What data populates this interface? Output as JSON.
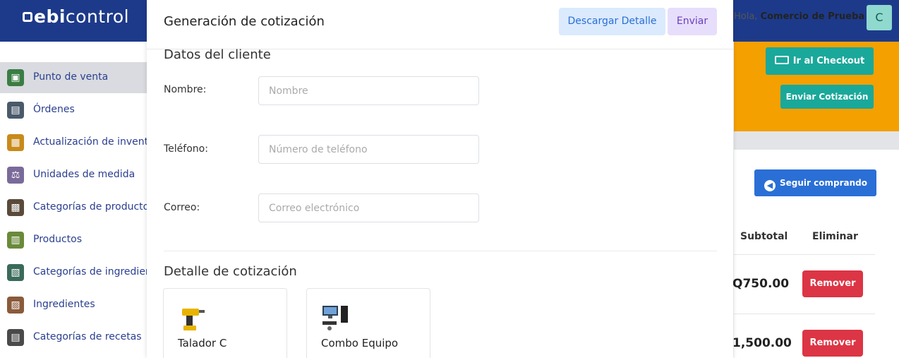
{
  "brand": {
    "bold": "ebi",
    "light": "control"
  },
  "header": {
    "greeting_prefix": "Hola, ",
    "user_name": "Comercio de Prueba",
    "avatar_letter": "C"
  },
  "sidebar": {
    "items": [
      {
        "label": "Punto de venta",
        "icon": "cash-register-icon"
      },
      {
        "label": "Órdenes",
        "icon": "orders-icon"
      },
      {
        "label": "Actualización de inventario",
        "icon": "inventory-icon"
      },
      {
        "label": "Unidades de medida",
        "icon": "scale-icon"
      },
      {
        "label": "Categorías de productos",
        "icon": "product-categories-icon"
      },
      {
        "label": "Productos",
        "icon": "products-icon"
      },
      {
        "label": "Categorías de ingredientes",
        "icon": "ingredient-categories-icon"
      },
      {
        "label": "Ingredientes",
        "icon": "ingredients-icon"
      },
      {
        "label": "Categorías de recetas",
        "icon": "recipe-categories-icon"
      }
    ]
  },
  "right": {
    "checkout_label": "Ir al Checkout",
    "send_quote_label": "Enviar Cotización",
    "continue_label": "Seguir comprando",
    "col_subtotal": "Subtotal",
    "col_remove": "Eliminar",
    "rows": [
      {
        "subtotal": "Q750.00",
        "remove_label": "Remover"
      },
      {
        "subtotal": "1,500.00",
        "remove_label": "Remover"
      }
    ]
  },
  "modal": {
    "title": "Generación de cotización",
    "download_label": "Descargar Detalle",
    "send_label": "Enviar",
    "client_section": "Datos del cliente",
    "name_label": "Nombre:",
    "name_placeholder": "Nombre",
    "phone_label": "Teléfono:",
    "phone_placeholder": "Número de teléfono",
    "email_label": "Correo:",
    "email_placeholder": "Correo electrónico",
    "detail_section": "Detalle de cotización",
    "products": [
      {
        "name": "Talador C",
        "icon": "drill-icon"
      },
      {
        "name": "Combo Equipo",
        "icon": "computer-icon"
      }
    ]
  },
  "colors": {
    "topbar": "#1d3a8a",
    "orange": "#f3a000",
    "teal": "#1aa89a",
    "blue": "#2a6fd6",
    "red": "#dc3545"
  }
}
